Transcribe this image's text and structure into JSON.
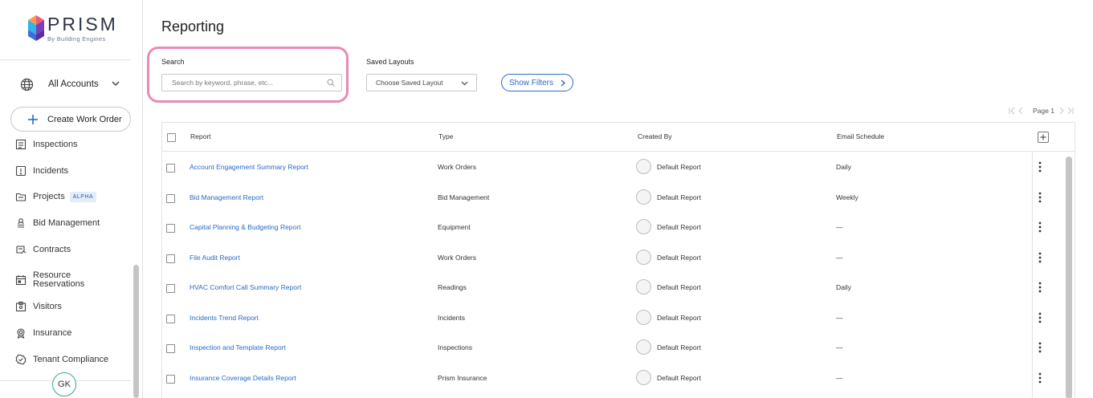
{
  "brand": {
    "name": "PRISM",
    "sub": "By Building Engines"
  },
  "account": {
    "label": "All Accounts"
  },
  "create_button": {
    "label": "Create Work Order"
  },
  "nav": [
    {
      "label": "Inspections",
      "icon": "checklist-icon"
    },
    {
      "label": "Incidents",
      "icon": "alert-icon"
    },
    {
      "label": "Projects",
      "icon": "folder-icon",
      "badge": "ALPHA"
    },
    {
      "label": "Bid Management",
      "icon": "person-stack-icon"
    },
    {
      "label": "Contracts",
      "icon": "contract-icon"
    },
    {
      "label": "Resource Reservations",
      "icon": "calendar-icon"
    },
    {
      "label": "Visitors",
      "icon": "badge-icon"
    },
    {
      "label": "Insurance",
      "icon": "certificate-icon"
    },
    {
      "label": "Tenant Compliance",
      "icon": "check-circle-icon"
    }
  ],
  "user": {
    "initials": "GK"
  },
  "page": {
    "title": "Reporting"
  },
  "search": {
    "label": "Search",
    "placeholder": "Search by keyword, phrase, etc..."
  },
  "saved_layouts": {
    "label": "Saved Layouts",
    "value": "Choose Saved Layout"
  },
  "filters_button": {
    "label": "Show Filters"
  },
  "pager": {
    "label": "Page 1"
  },
  "table": {
    "columns": [
      "Report",
      "Type",
      "Created By",
      "Email Schedule"
    ],
    "rows": [
      {
        "report": "Account Engagement Summary Report",
        "type": "Work Orders",
        "created_by": "Default Report",
        "schedule": "Daily"
      },
      {
        "report": "Bid Management Report",
        "type": "Bid Management",
        "created_by": "Default Report",
        "schedule": "Weekly"
      },
      {
        "report": "Capital Planning & Budgeting Report",
        "type": "Equipment",
        "created_by": "Default Report",
        "schedule": "—"
      },
      {
        "report": "File Audit Report",
        "type": "Work Orders",
        "created_by": "Default Report",
        "schedule": "—"
      },
      {
        "report": "HVAC Comfort Call Summary Report",
        "type": "Readings",
        "created_by": "Default Report",
        "schedule": "Daily"
      },
      {
        "report": "Incidents Trend Report",
        "type": "Incidents",
        "created_by": "Default Report",
        "schedule": "—"
      },
      {
        "report": "Inspection and Template Report",
        "type": "Inspections",
        "created_by": "Default Report",
        "schedule": "—"
      },
      {
        "report": "Insurance Coverage Details Report",
        "type": "Prism Insurance",
        "created_by": "Default Report",
        "schedule": "—"
      }
    ]
  },
  "colors": {
    "link": "#2a6ac9",
    "highlight": "#e88bb8",
    "avatar_ring": "#2ea88f"
  }
}
